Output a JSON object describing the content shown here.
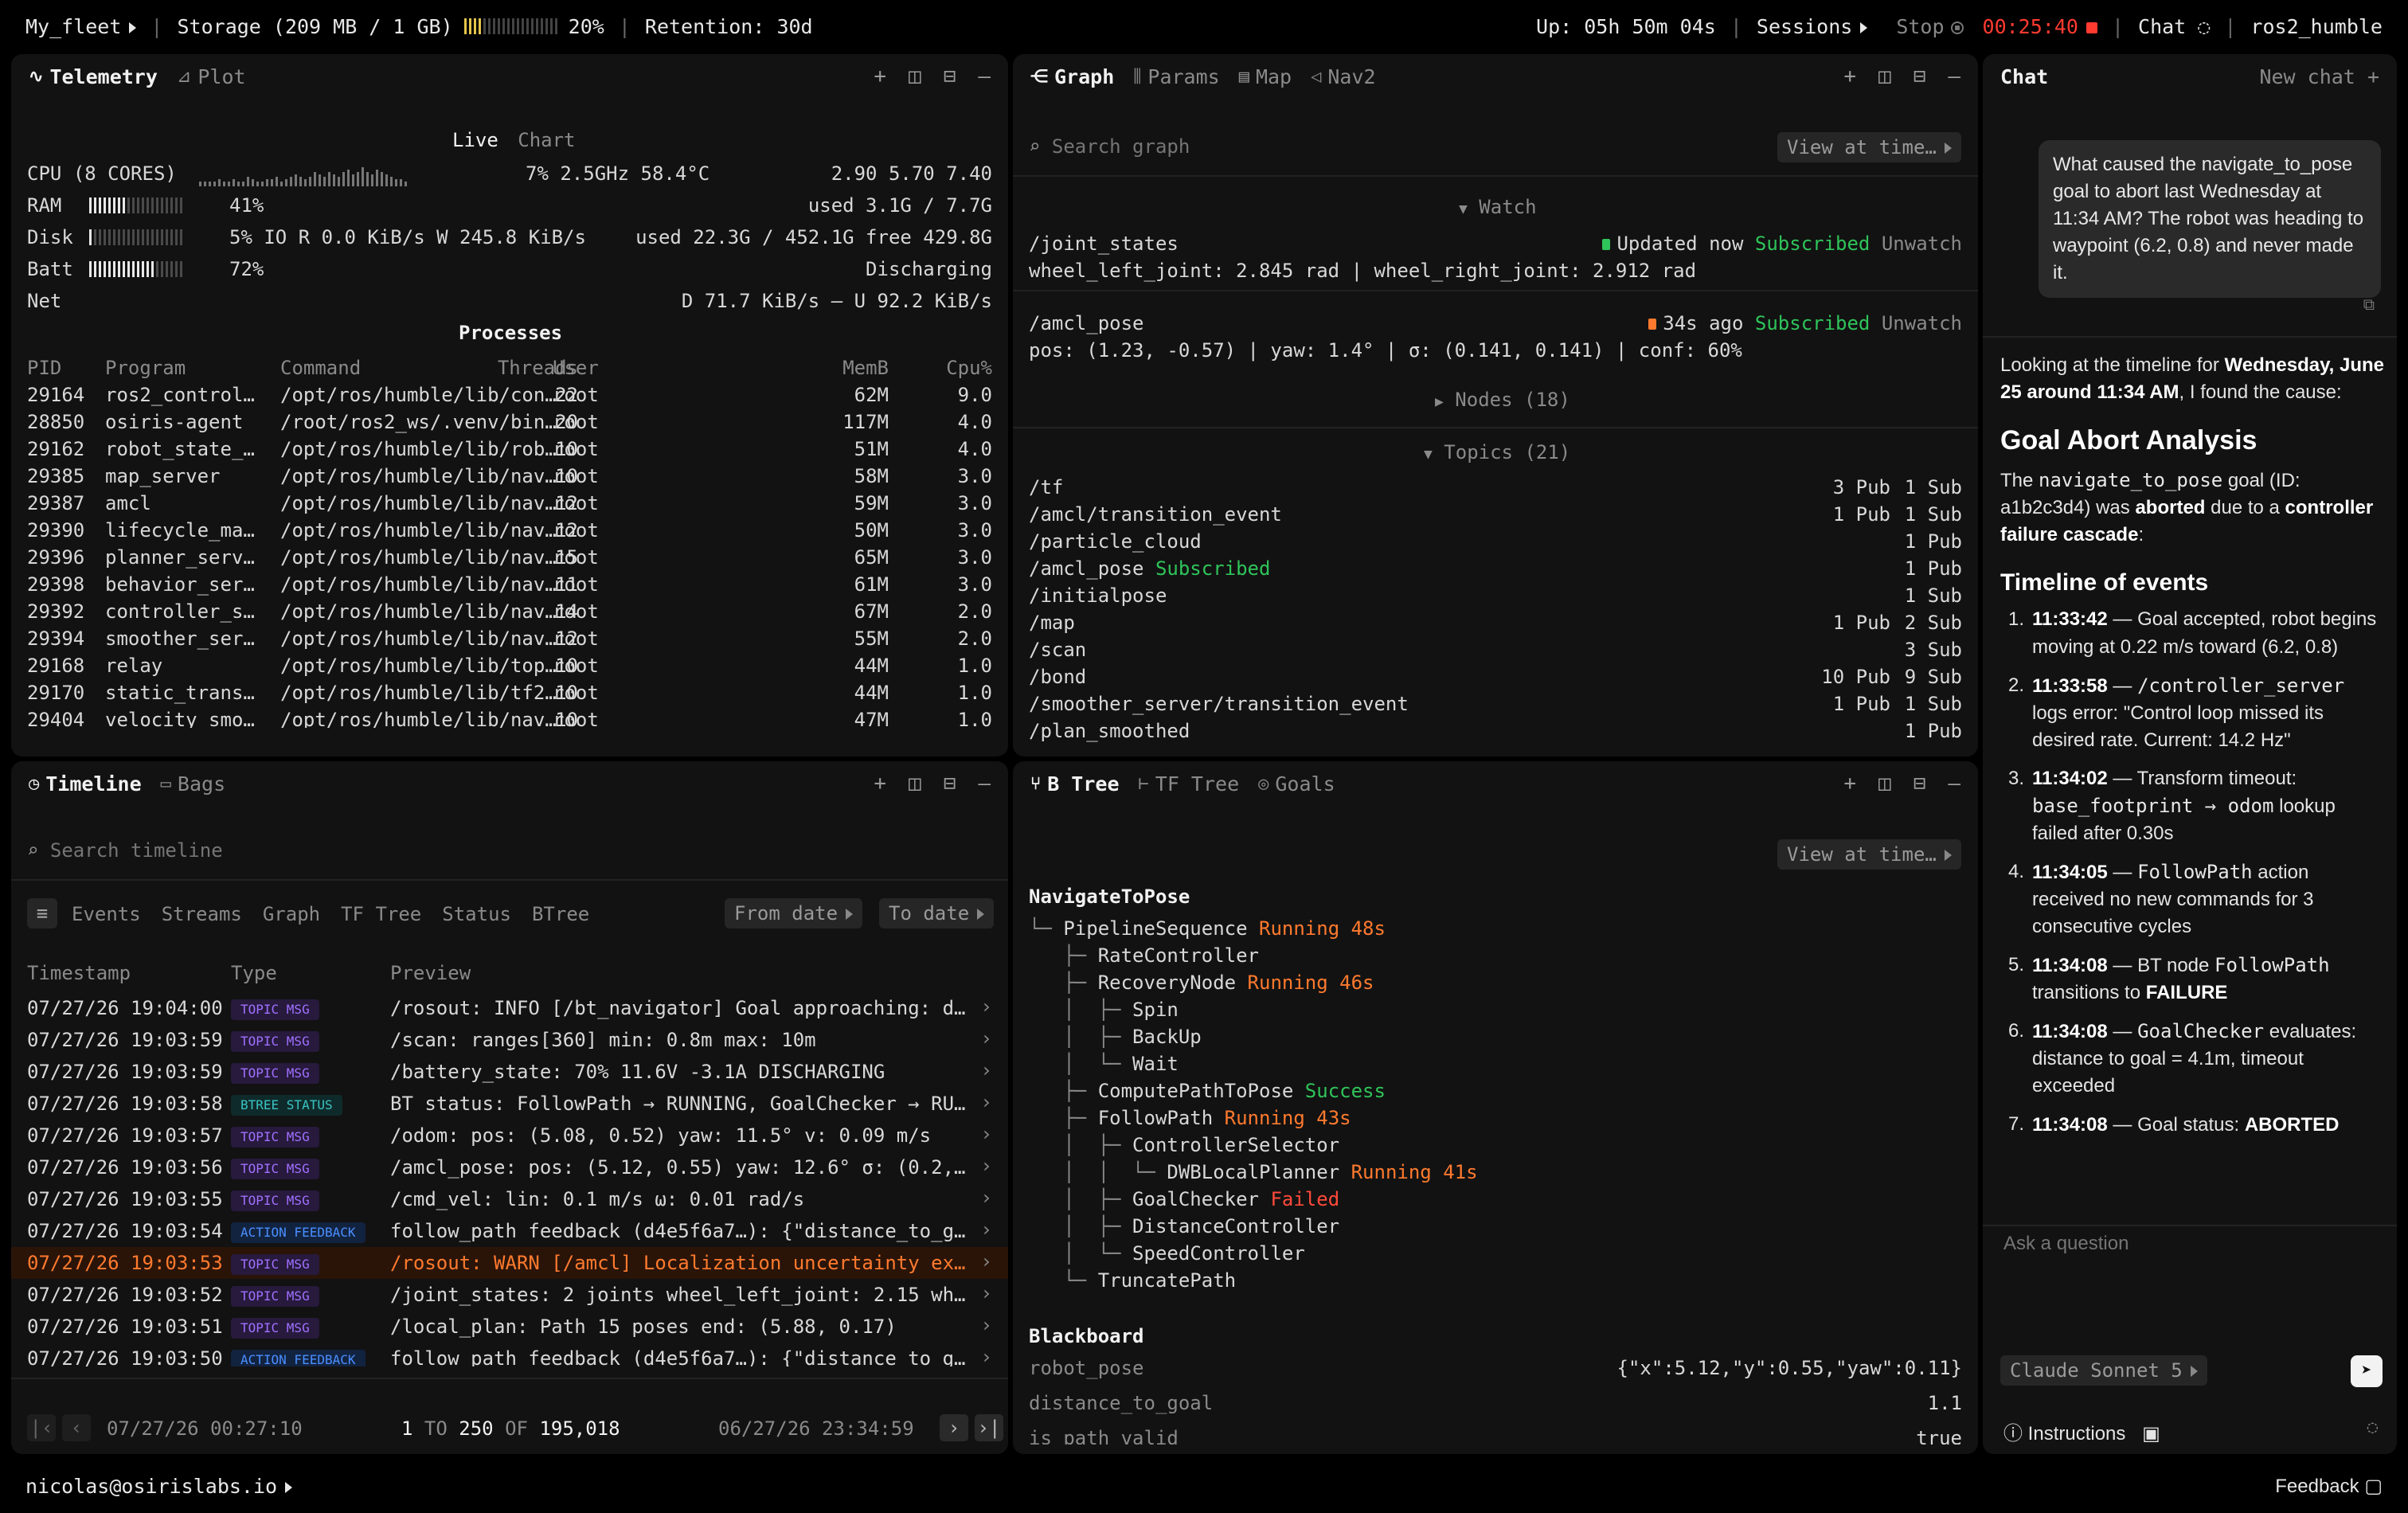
{
  "topbar": {
    "fleet": "My_fleet",
    "storage": "Storage (209 MB / 1 GB)",
    "storage_pct": "20%",
    "storage_fraction": 0.2,
    "retention": "Retention: 30d",
    "uptime": "Up: 05h 50m 04s",
    "sessions": "Sessions",
    "stop": "Stop",
    "rec_time": "00:25:40",
    "chat": "Chat",
    "robot": "ros2_humble"
  },
  "telemetry": {
    "tabs": [
      "Telemetry",
      "Plot"
    ],
    "view_live": "Live",
    "view_chart": "Chart",
    "cpu": {
      "label": "CPU",
      "cores": "(8 CORES)",
      "pct": "7%",
      "freq": "2.5GHz",
      "temp": "58.4°C",
      "load": "2.90 5.70 7.40"
    },
    "ram": {
      "label": "RAM",
      "pct": "41%",
      "fraction": 0.41,
      "detail": "used 3.1G / 7.7G"
    },
    "disk": {
      "label": "Disk",
      "pct": "5%",
      "fraction": 0.05,
      "io": "IO R 0.0 KiB/s W 245.8 KiB/s",
      "detail": "used 22.3G / 452.1G free 429.8G"
    },
    "batt": {
      "label": "Batt",
      "pct": "72%",
      "fraction": 0.72,
      "detail": "Discharging"
    },
    "net": {
      "label": "Net",
      "detail": "D 71.7 KiB/s — U 92.2 KiB/s"
    },
    "processes_title": "Processes",
    "columns": [
      "PID",
      "Program",
      "Command",
      "Threads",
      "User",
      "MemB",
      "Cpu%"
    ],
    "rows": [
      [
        "29164",
        "ros2_control…",
        "/opt/ros/humble/lib/con…",
        "22",
        "root",
        "62M",
        "9.0"
      ],
      [
        "28850",
        "osiris-agent",
        "/root/ros2_ws/.venv/bin…",
        "20",
        "root",
        "117M",
        "4.0"
      ],
      [
        "29162",
        "robot_state_…",
        "/opt/ros/humble/lib/rob…",
        "10",
        "root",
        "51M",
        "4.0"
      ],
      [
        "29385",
        "map_server",
        "/opt/ros/humble/lib/nav…",
        "10",
        "root",
        "58M",
        "3.0"
      ],
      [
        "29387",
        "amcl",
        "/opt/ros/humble/lib/nav…",
        "12",
        "root",
        "59M",
        "3.0"
      ],
      [
        "29390",
        "lifecycle_ma…",
        "/opt/ros/humble/lib/nav…",
        "12",
        "root",
        "50M",
        "3.0"
      ],
      [
        "29396",
        "planner_serv…",
        "/opt/ros/humble/lib/nav…",
        "15",
        "root",
        "65M",
        "3.0"
      ],
      [
        "29398",
        "behavior_ser…",
        "/opt/ros/humble/lib/nav…",
        "11",
        "root",
        "61M",
        "3.0"
      ],
      [
        "29392",
        "controller_s…",
        "/opt/ros/humble/lib/nav…",
        "14",
        "root",
        "67M",
        "2.0"
      ],
      [
        "29394",
        "smoother_ser…",
        "/opt/ros/humble/lib/nav…",
        "12",
        "root",
        "55M",
        "2.0"
      ],
      [
        "29168",
        "relay",
        "/opt/ros/humble/lib/top…",
        "10",
        "root",
        "44M",
        "1.0"
      ],
      [
        "29170",
        "static_trans…",
        "/opt/ros/humble/lib/tf2…",
        "10",
        "root",
        "44M",
        "1.0"
      ],
      [
        "29404",
        "velocity_smo…",
        "/opt/ros/humble/lib/nav…",
        "10",
        "root",
        "47M",
        "1.0"
      ]
    ]
  },
  "graph": {
    "tabs": [
      "Graph",
      "Params",
      "Map",
      "Nav2"
    ],
    "search_placeholder": "Search graph",
    "view_at_time": "View at time…",
    "watch_label": "Watch",
    "watch": [
      {
        "topic": "/joint_states",
        "status": "Updated now",
        "sub": "Subscribed",
        "action": "Unwatch",
        "value": "wheel_left_joint: 2.845 rad | wheel_right_joint: 2.912 rad",
        "color": "#2fc45a"
      },
      {
        "topic": "/amcl_pose",
        "status": "34s ago",
        "sub": "Subscribed",
        "action": "Unwatch",
        "value": "pos: (1.23, -0.57) | yaw: 1.4° | σ: (0.141, 0.141) | conf: 60%",
        "color": "#ff7a2e"
      }
    ],
    "nodes_label": "Nodes (18)",
    "topics_label": "Topics (21)",
    "topics": [
      {
        "name": "/tf",
        "tag": "",
        "pub": "3 Pub",
        "sub": "1 Sub"
      },
      {
        "name": "/amcl/transition_event",
        "tag": "",
        "pub": "1 Pub",
        "sub": "1 Sub"
      },
      {
        "name": "/particle_cloud",
        "tag": "",
        "pub": "",
        "sub": "1 Pub"
      },
      {
        "name": "/amcl_pose",
        "tag": "Subscribed",
        "pub": "",
        "sub": "1 Pub"
      },
      {
        "name": "/initialpose",
        "tag": "",
        "pub": "",
        "sub": "1 Sub"
      },
      {
        "name": "/map",
        "tag": "",
        "pub": "1 Pub",
        "sub": "2 Sub"
      },
      {
        "name": "/scan",
        "tag": "",
        "pub": "",
        "sub": "3 Sub"
      },
      {
        "name": "/bond",
        "tag": "",
        "pub": "10 Pub",
        "sub": "9 Sub"
      },
      {
        "name": "/smoother_server/transition_event",
        "tag": "",
        "pub": "1 Pub",
        "sub": "1 Sub"
      },
      {
        "name": "/plan_smoothed",
        "tag": "",
        "pub": "",
        "sub": "1 Pub"
      }
    ]
  },
  "timeline": {
    "tabs": [
      "Timeline",
      "Bags"
    ],
    "search_placeholder": "Search timeline",
    "filters": [
      "Events",
      "Streams",
      "Graph",
      "TF Tree",
      "Status",
      "BTree"
    ],
    "from_date": "From date",
    "to_date": "To date",
    "columns": [
      "Timestamp",
      "Type",
      "Preview"
    ],
    "rows": [
      {
        "ts": "07/27/26 19:04:00",
        "type": "TOPIC MSG",
        "kind": "topic",
        "preview": "/rosout: INFO [/bt_navigator] Goal approaching: d…",
        "warn": false
      },
      {
        "ts": "07/27/26 19:03:59",
        "type": "TOPIC MSG",
        "kind": "topic",
        "preview": "/scan: ranges[360] min: 0.8m max: 10m",
        "warn": false
      },
      {
        "ts": "07/27/26 19:03:59",
        "type": "TOPIC MSG",
        "kind": "topic",
        "preview": "/battery_state: 70% 11.6V -3.1A DISCHARGING",
        "warn": false
      },
      {
        "ts": "07/27/26 19:03:58",
        "type": "BTREE STATUS",
        "kind": "btree",
        "preview": "BT status: FollowPath → RUNNING, GoalChecker → RU…",
        "warn": false
      },
      {
        "ts": "07/27/26 19:03:57",
        "type": "TOPIC MSG",
        "kind": "topic",
        "preview": "/odom: pos: (5.08, 0.52) yaw: 11.5° v: 0.09 m/s",
        "warn": false
      },
      {
        "ts": "07/27/26 19:03:56",
        "type": "TOPIC MSG",
        "kind": "topic",
        "preview": "/amcl_pose: pos: (5.12, 0.55) yaw: 12.6° σ: (0.2,…",
        "warn": false
      },
      {
        "ts": "07/27/26 19:03:55",
        "type": "TOPIC MSG",
        "kind": "topic",
        "preview": "/cmd_vel: lin: 0.1 m/s ω: 0.01 rad/s",
        "warn": false
      },
      {
        "ts": "07/27/26 19:03:54",
        "type": "ACTION FEEDBACK",
        "kind": "action",
        "preview": "follow_path feedback (d4e5f6a7…): {\"distance_to_g…",
        "warn": false
      },
      {
        "ts": "07/27/26 19:03:53",
        "type": "TOPIC MSG",
        "kind": "topic",
        "preview": "/rosout: WARN [/amcl] Localization uncertainty ex…",
        "warn": true
      },
      {
        "ts": "07/27/26 19:03:52",
        "type": "TOPIC MSG",
        "kind": "topic",
        "preview": "/joint_states: 2 joints wheel_left_joint: 2.15 wh…",
        "warn": false
      },
      {
        "ts": "07/27/26 19:03:51",
        "type": "TOPIC MSG",
        "kind": "topic",
        "preview": "/local_plan: Path 15 poses end: (5.88, 0.17)",
        "warn": false
      },
      {
        "ts": "07/27/26 19:03:50",
        "type": "ACTION FEEDBACK",
        "kind": "action",
        "preview": "follow_path feedback (d4e5f6a7…): {\"distance_to_g…",
        "warn": false
      }
    ],
    "footer": {
      "start": "07/27/26 00:27:10",
      "from": "1",
      "to_word": "TO",
      "to": "250",
      "of_word": "OF",
      "total": "195,018",
      "end": "06/27/26 23:34:59"
    }
  },
  "btree": {
    "tabs": [
      "B Tree",
      "TF Tree",
      "Goals"
    ],
    "view_at_time": "View at time…",
    "root": "NavigateToPose",
    "lines": [
      {
        "prefix": "└─ ",
        "name": "PipelineSequence",
        "status": "Running 48s",
        "sc": "orange"
      },
      {
        "prefix": "   ├─ ",
        "name": "RateController",
        "status": "",
        "sc": ""
      },
      {
        "prefix": "   ├─ ",
        "name": "RecoveryNode",
        "status": "Running 46s",
        "sc": "orange"
      },
      {
        "prefix": "   │  ├─ ",
        "name": "Spin",
        "status": "",
        "sc": ""
      },
      {
        "prefix": "   │  ├─ ",
        "name": "BackUp",
        "status": "",
        "sc": ""
      },
      {
        "prefix": "   │  └─ ",
        "name": "Wait",
        "status": "",
        "sc": ""
      },
      {
        "prefix": "   ├─ ",
        "name": "ComputePathToPose",
        "status": "Success",
        "sc": "green"
      },
      {
        "prefix": "   ├─ ",
        "name": "FollowPath",
        "status": "Running 43s",
        "sc": "orange"
      },
      {
        "prefix": "   │  ├─ ",
        "name": "ControllerSelector",
        "status": "",
        "sc": ""
      },
      {
        "prefix": "   │  │  └─ ",
        "name": "DWBLocalPlanner",
        "status": "Running 41s",
        "sc": "orange"
      },
      {
        "prefix": "   │  ├─ ",
        "name": "GoalChecker",
        "status": "Failed",
        "sc": "red"
      },
      {
        "prefix": "   │  ├─ ",
        "name": "DistanceController",
        "status": "",
        "sc": ""
      },
      {
        "prefix": "   │  └─ ",
        "name": "SpeedController",
        "status": "",
        "sc": ""
      },
      {
        "prefix": "   └─ ",
        "name": "TruncatePath",
        "status": "",
        "sc": ""
      }
    ],
    "blackboard_title": "Blackboard",
    "blackboard": [
      {
        "key": "robot_pose",
        "value": "{\"x\":5.12,\"y\":0.55,\"yaw\":0.11}"
      },
      {
        "key": "distance_to_goal",
        "value": "1.1"
      },
      {
        "key": "is_path_valid",
        "value": "true"
      }
    ]
  },
  "chat": {
    "title": "Chat",
    "new_chat": "New chat",
    "user_message": "What caused the navigate_to_pose goal to abort last Wednesday at 11:34 AM? The robot was heading to waypoint (6.2, 0.8) and never made it.",
    "intro_pre": "Looking at the timeline for ",
    "intro_bold": "Wednesday, June 25 around 11:34 AM",
    "intro_post": ", I found the cause:",
    "h1": "Goal Abort Analysis",
    "p1_a": "The ",
    "p1_code": "navigate_to_pose",
    "p1_b": " goal (ID: a1b2c3d4) was ",
    "p1_bold1": "aborted",
    "p1_c": " due to a ",
    "p1_bold2": "controller failure cascade",
    "p1_d": ":",
    "h2": "Timeline of events",
    "events": [
      {
        "n": "1.",
        "t": "11:33:42",
        "pre": " — Goal accepted, robot begins moving at 0.22 m/s toward (6.2, 0.8)",
        "code": "",
        "post": "",
        "bold": ""
      },
      {
        "n": "2.",
        "t": "11:33:58",
        "pre": " — ",
        "code": "/controller_server",
        "post": " logs error: \"Control loop missed its desired rate. Current: 14.2 Hz\"",
        "bold": ""
      },
      {
        "n": "3.",
        "t": "11:34:02",
        "pre": " — Transform timeout: ",
        "code": "base_footprint → odom",
        "post": " lookup failed after 0.30s",
        "bold": ""
      },
      {
        "n": "4.",
        "t": "11:34:05",
        "pre": " — ",
        "code": "FollowPath",
        "post": " action received no new commands for 3 consecutive cycles",
        "bold": ""
      },
      {
        "n": "5.",
        "t": "11:34:08",
        "pre": " — BT node ",
        "code": "FollowPath",
        "post": " transitions to ",
        "bold": "FAILURE"
      },
      {
        "n": "6.",
        "t": "11:34:08",
        "pre": " — ",
        "code": "GoalChecker",
        "post": " evaluates: distance to goal = 4.1m, timeout exceeded",
        "bold": ""
      },
      {
        "n": "7.",
        "t": "11:34:08",
        "pre": " — Goal status: ",
        "code": "",
        "post": "",
        "bold": "ABORTED"
      }
    ],
    "input_placeholder": "Ask a question",
    "model": "Claude Sonnet 5",
    "instructions": "Instructions"
  },
  "footer": {
    "user": "nicolas@osirislabs.io",
    "feedback": "Feedback"
  }
}
